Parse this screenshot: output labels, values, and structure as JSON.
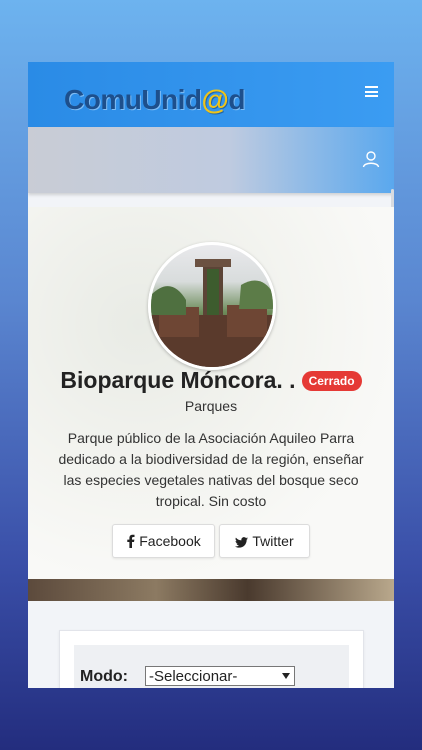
{
  "app": {
    "logo_prefix": "ComuUnid",
    "logo_at": "@",
    "logo_suffix": "d"
  },
  "place": {
    "name": "Bioparque Móncora. .",
    "status": "Cerrado",
    "category": "Parques",
    "description": "Parque público de la Asociación Aquileo Parra dedicado a la biodiversidad de la región, enseñar las especies vegetales nativas del bosque seco tropical. Sin costo"
  },
  "social": {
    "facebook": "Facebook",
    "twitter": "Twitter"
  },
  "filter": {
    "label": "Modo:",
    "selected": "-Seleccionar-"
  },
  "colors": {
    "topbar": "#2a8be6",
    "badge": "#e53935"
  }
}
